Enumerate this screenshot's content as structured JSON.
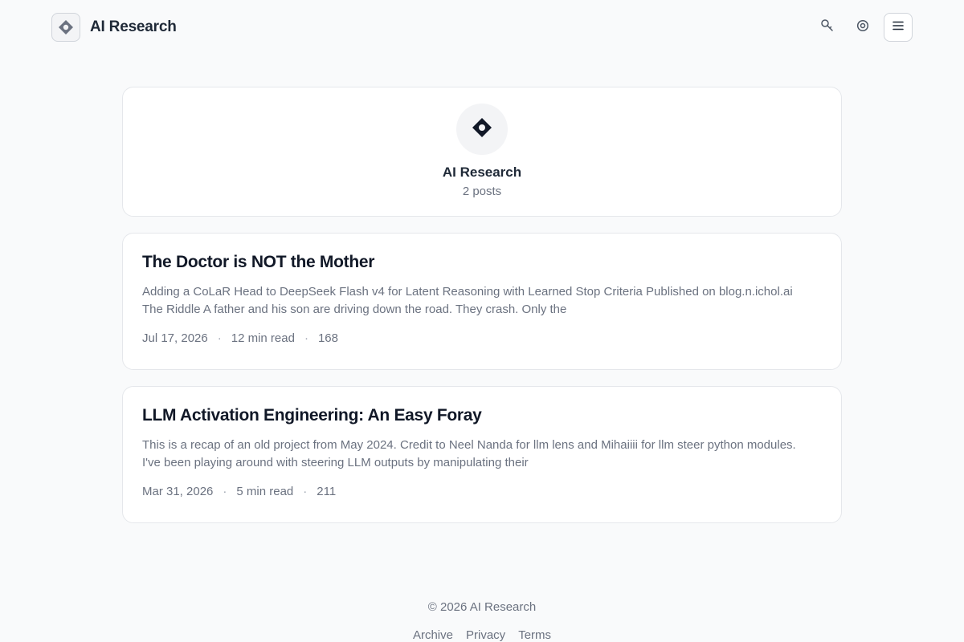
{
  "header": {
    "brand_name": "AI Research",
    "actions": {
      "search_icon": "search-icon",
      "theme_icon": "settings-gear-icon",
      "menu_icon": "hamburger-menu-icon"
    }
  },
  "profile": {
    "name": "AI Research",
    "post_count": "2 posts"
  },
  "posts": [
    {
      "title": "The Doctor is NOT the Mother",
      "excerpt": "Adding a CoLaR Head to DeepSeek Flash v4 for Latent Reasoning with Learned Stop Criteria Published on blog.n.ichol.ai The Riddle A father and his son are driving down the road. They crash. Only the",
      "date": "Jul 17, 2026",
      "read_time": "12 min read",
      "views": "168"
    },
    {
      "title": "LLM Activation Engineering: An Easy Foray",
      "excerpt": "This is a recap of an old project from May 2024. Credit to Neel Nanda for llm lens and Mihaiiii for llm steer python modules. I've been playing around with steering LLM outputs by manipulating their",
      "date": "Mar 31, 2026",
      "read_time": "5 min read",
      "views": "211"
    }
  ],
  "meta_separator": "·",
  "footer": {
    "copyright": "© 2026 AI Research",
    "links": [
      "Archive",
      "Privacy",
      "Terms"
    ]
  },
  "colors": {
    "background": "#f9fafb",
    "card": "#ffffff",
    "border": "#e5e7eb",
    "text_primary": "#111827",
    "text_muted": "#6b7280"
  }
}
